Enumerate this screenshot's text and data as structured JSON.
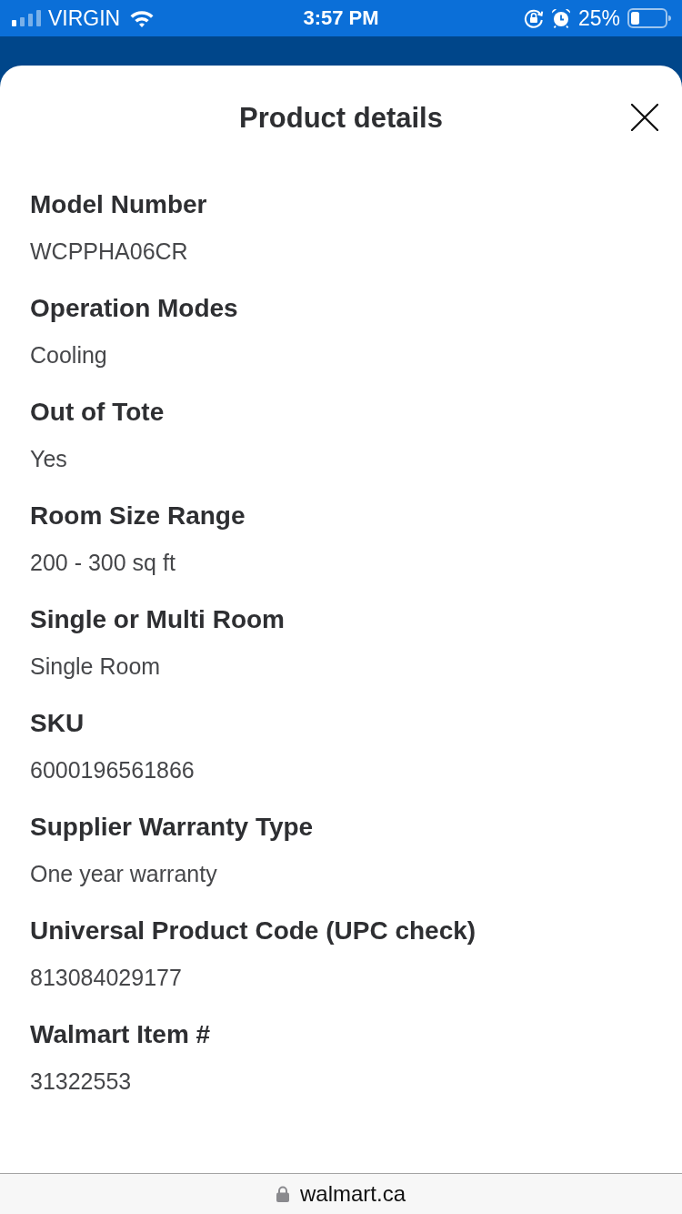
{
  "status_bar": {
    "carrier": "VIRGIN",
    "time": "3:57 PM",
    "battery": "25%"
  },
  "sheet": {
    "title": "Product details",
    "details": [
      {
        "label": "Model Number",
        "value": "WCPPHA06CR"
      },
      {
        "label": "Operation Modes",
        "value": "Cooling"
      },
      {
        "label": "Out of Tote",
        "value": "Yes"
      },
      {
        "label": "Room Size Range",
        "value": "200 - 300 sq ft"
      },
      {
        "label": "Single or Multi Room",
        "value": "Single Room"
      },
      {
        "label": "SKU",
        "value": "6000196561866"
      },
      {
        "label": "Supplier Warranty Type",
        "value": "One year warranty"
      },
      {
        "label": "Universal Product Code (UPC check)",
        "value": "813084029177"
      },
      {
        "label": "Walmart Item #",
        "value": "31322553"
      }
    ]
  },
  "browser_bar": {
    "url": "walmart.ca"
  }
}
